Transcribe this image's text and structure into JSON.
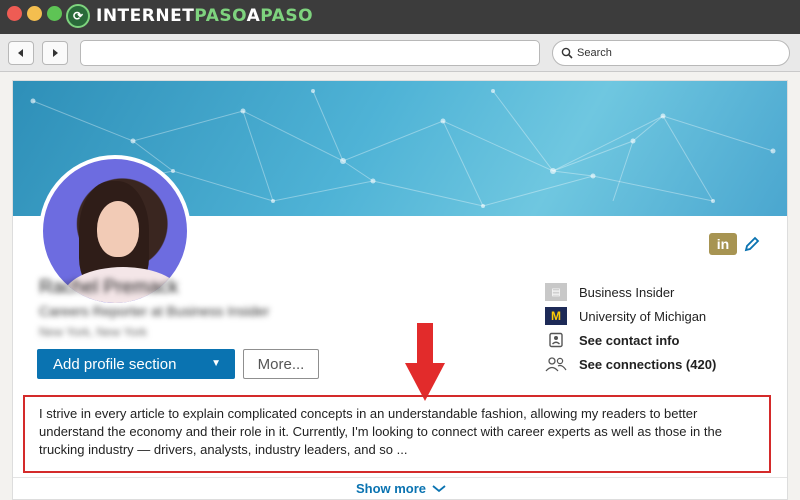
{
  "browser": {
    "brand": {
      "part1": "INTERNET",
      "part2": "PASO",
      "part3": "A",
      "part4": "PASO"
    },
    "search_placeholder": "Search",
    "url_value": ""
  },
  "profile": {
    "name": "Rachel Premack",
    "headline": "Careers Reporter at Business Insider",
    "location": "New York, New York",
    "add_section_label": "Add profile section",
    "more_label": "More...",
    "linkedin_badge": "in",
    "sidebar": {
      "company": "Business Insider",
      "school": "University of Michigan",
      "school_badge": "M",
      "contact": "See contact info",
      "connections": "See connections (420)"
    },
    "about": {
      "text": "I strive in every article to explain complicated concepts in an understandable fashion, allowing my readers to better understand the economy and their role in it. Currently, I'm looking to connect with career experts as well as those in the trucking industry — drivers, analysts, industry leaders, and so ...",
      "show_more_label": "Show more"
    }
  },
  "colors": {
    "accent_blue": "#0a73b1",
    "highlight_red": "#d42a2a",
    "linkedin_gold": "#a79452"
  }
}
